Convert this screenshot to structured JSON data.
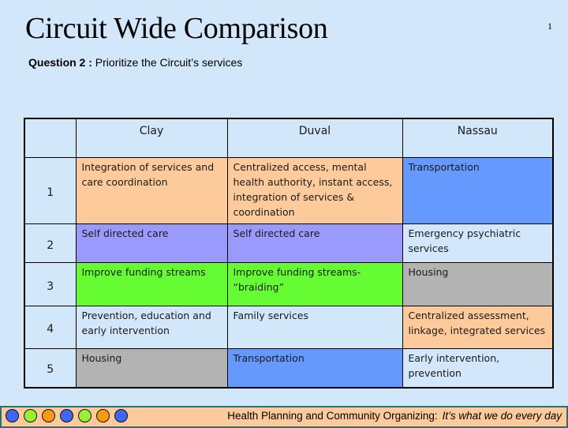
{
  "slide": {
    "title": "Circuit Wide Comparison",
    "number": "1",
    "question_label": "Question 2 :",
    "question_text": "Prioritize the Circuit’s services"
  },
  "colors": {
    "background": "#d3e7fb",
    "orange": "#fdcb9b",
    "purple": "#9a9afd",
    "green": "#66fc33",
    "gray": "#b3b3b3",
    "blue": "#6699fd",
    "light": "#d3e7fb"
  },
  "table": {
    "columns": [
      "",
      "Clay",
      "Duval",
      "Nassau"
    ],
    "rows": [
      {
        "rank": "1",
        "cells": [
          {
            "text": "Integration of services and care coordination",
            "color": "orange"
          },
          {
            "text": "Centralized access, mental health authority, instant access, integration of services & coordination",
            "color": "orange"
          },
          {
            "text": "Transportation",
            "color": "blue"
          }
        ]
      },
      {
        "rank": "2",
        "cells": [
          {
            "text": "Self directed care",
            "color": "purple"
          },
          {
            "text": "Self directed care",
            "color": "purple"
          },
          {
            "text": "Emergency psychiatric services",
            "color": "light"
          }
        ]
      },
      {
        "rank": "3",
        "cells": [
          {
            "text": "Improve funding streams",
            "color": "green"
          },
          {
            "text": "Improve funding streams- “braiding”",
            "color": "green"
          },
          {
            "text": "Housing",
            "color": "gray"
          }
        ]
      },
      {
        "rank": "4",
        "cells": [
          {
            "text": "Prevention, education and early intervention",
            "color": "light"
          },
          {
            "text": "Family services",
            "color": "light"
          },
          {
            "text": "Centralized assessment, linkage, integrated services",
            "color": "orange"
          }
        ]
      },
      {
        "rank": "5",
        "cells": [
          {
            "text": "Housing",
            "color": "gray"
          },
          {
            "text": "Transportation",
            "color": "blue"
          },
          {
            "text": "Early intervention, prevention",
            "color": "light"
          }
        ]
      }
    ]
  },
  "footer": {
    "dots": [
      "#3f66f5",
      "#99f033",
      "#f99a10",
      "#3f66f5",
      "#99f033",
      "#f99a10",
      "#3f66f5"
    ],
    "text": "Health Planning and Community Organizing:",
    "tagline": "It’s what we do every day"
  }
}
